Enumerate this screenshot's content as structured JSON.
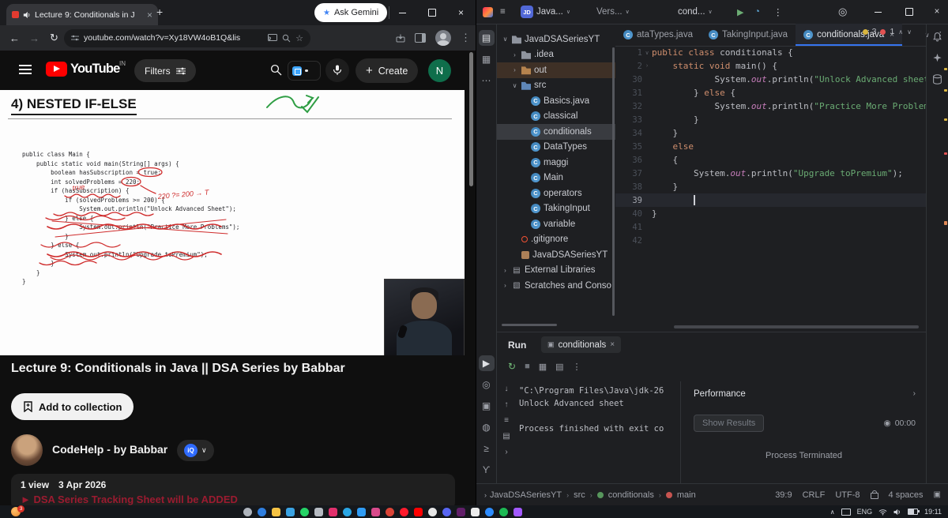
{
  "browser": {
    "tab_title": "Lecture 9: Conditionals in J",
    "ask_gemini": "Ask Gemini",
    "url": "youtube.com/watch?v=Xy18VW4oB1Q&lis",
    "yt": {
      "logo": "YouTube",
      "region": "IN",
      "filters": "Filters",
      "create": "Create",
      "avatar_initial": "N",
      "heading": "4) NESTED IF-ELSE",
      "whiteboard": {
        "code": [
          "public class Main {",
          "    public static void main(String[] args) {",
          "        boolean hasSubscription = true;",
          "        int solvedProblems = 220;",
          "        if (hasSubscription) {",
          "            if (solvedProblems >= 200) {",
          "                System.out.println(\"Unlock Advanced Sheet\");",
          "            } else {",
          "                System.out.println(\"Practice More Problems\");",
          "            }",
          "        } else {",
          "            System.out.println(\"Upgrade toPremium\");",
          "        }",
          "    }",
          "}"
        ]
      },
      "annotations": {
        "expr": "220 ?= 200 → T",
        "true_note": "true"
      },
      "title": "Lecture 9: Conditionals in Java || DSA Series by Babbar",
      "add_to_collection": "Add to collection",
      "channel": "CodeHelp - by Babbar",
      "badge": "iQ",
      "views": "1 view",
      "date": "3 Apr 2026",
      "banner": "► DSA Series Tracking Sheet will be ADDED"
    }
  },
  "ide": {
    "titlebar": {
      "project_avatar": "JD",
      "project_short": "Java...",
      "vcs_short": "Vers...",
      "run_config_short": "cond..."
    },
    "left_strip_top": [
      {
        "name": "project-tool-icon",
        "glyph": "▤",
        "active": true
      },
      {
        "name": "structure-tool-icon",
        "glyph": "▦"
      },
      {
        "name": "more-tools-icon",
        "glyph": "⋯"
      }
    ],
    "left_strip_bottom": [
      {
        "name": "run-tool-icon",
        "glyph": "▶",
        "active": true
      },
      {
        "name": "services-tool-icon",
        "glyph": "◎"
      },
      {
        "name": "build-tool-icon",
        "glyph": "▣"
      },
      {
        "name": "problems-tool-icon",
        "glyph": "◍"
      },
      {
        "name": "terminal-tool-icon",
        "glyph": "≥"
      },
      {
        "name": "git-tool-icon",
        "glyph": "ϒ"
      }
    ],
    "project_tree": [
      {
        "label": "JavaDSASeriesYT",
        "indent": 0,
        "chevron": "v",
        "icon": "folder"
      },
      {
        "label": ".idea",
        "indent": 1,
        "chevron": ">",
        "icon": "folder"
      },
      {
        "label": "out",
        "indent": 1,
        "chevron": ">",
        "icon": "folder-out",
        "tint": true
      },
      {
        "label": "src",
        "indent": 1,
        "chevron": "v",
        "icon": "folder-src"
      },
      {
        "label": "Basics.java",
        "indent": 2,
        "icon": "class"
      },
      {
        "label": "classical",
        "indent": 2,
        "icon": "class"
      },
      {
        "label": "conditionals",
        "indent": 2,
        "icon": "class",
        "selected": true
      },
      {
        "label": "DataTypes",
        "indent": 2,
        "icon": "class"
      },
      {
        "label": "maggi",
        "indent": 2,
        "icon": "class"
      },
      {
        "label": "Main",
        "indent": 2,
        "icon": "class"
      },
      {
        "label": "operators",
        "indent": 2,
        "icon": "class"
      },
      {
        "label": "TakingInput",
        "indent": 2,
        "icon": "class"
      },
      {
        "label": "variable",
        "indent": 2,
        "icon": "class"
      },
      {
        "label": ".gitignore",
        "indent": 1,
        "icon": "git"
      },
      {
        "label": "JavaDSASeriesYT",
        "indent": 1,
        "icon": "module"
      },
      {
        "label": "External Libraries",
        "indent": 0,
        "chevron": ">",
        "icon": "lib"
      },
      {
        "label": "Scratches and Conso",
        "indent": 0,
        "chevron": ">",
        "icon": "scratch"
      }
    ],
    "tabs": [
      {
        "label": "ataTypes.java"
      },
      {
        "label": "TakingInput.java"
      },
      {
        "label": "conditionals.java",
        "active": true
      }
    ],
    "inspections": {
      "warnings": "3",
      "errors": "1"
    },
    "editor": {
      "lines": [
        {
          "n": "1",
          "fold": "v",
          "s": [
            [
              "kw",
              "public class "
            ],
            [
              "pl",
              "conditionals {"
            ]
          ]
        },
        {
          "n": "2",
          "fold": ">",
          "s": [
            [
              "pl",
              "    "
            ],
            [
              "kw",
              "static void "
            ],
            [
              "pl",
              "main() {"
            ]
          ]
        },
        {
          "n": "30",
          "s": [
            [
              "pl",
              "            System."
            ],
            [
              "fld",
              "out"
            ],
            [
              "pl",
              ".println("
            ],
            [
              "str",
              "\"Unlock Advanced sheet"
            ]
          ]
        },
        {
          "n": "31",
          "s": [
            [
              "pl",
              "        } "
            ],
            [
              "kw",
              "else"
            ],
            [
              "pl",
              " {"
            ]
          ]
        },
        {
          "n": "32",
          "s": [
            [
              "pl",
              "            System."
            ],
            [
              "fld",
              "out"
            ],
            [
              "pl",
              ".println("
            ],
            [
              "str",
              "\"Practice More Problem"
            ]
          ]
        },
        {
          "n": "33",
          "s": [
            [
              "pl",
              "        }"
            ]
          ]
        },
        {
          "n": "34",
          "s": [
            [
              "pl",
              "    }"
            ]
          ]
        },
        {
          "n": "35",
          "s": [
            [
              "pl",
              "    "
            ],
            [
              "kw",
              "else"
            ]
          ]
        },
        {
          "n": "36",
          "s": [
            [
              "pl",
              "    {"
            ]
          ]
        },
        {
          "n": "37",
          "s": [
            [
              "pl",
              "        System."
            ],
            [
              "fld",
              "out"
            ],
            [
              "pl",
              ".println("
            ],
            [
              "str",
              "\"Upgrade toPremium\""
            ],
            [
              "pl",
              ");"
            ]
          ]
        },
        {
          "n": "38",
          "s": [
            [
              "pl",
              "    }"
            ]
          ]
        },
        {
          "n": "39",
          "s": [],
          "current": true
        },
        {
          "n": "40",
          "s": [
            [
              "pl",
              "}"
            ]
          ]
        },
        {
          "n": "41",
          "s": []
        },
        {
          "n": "42",
          "s": []
        }
      ]
    },
    "run": {
      "label": "Run",
      "tab": "conditionals",
      "console": [
        "\"C:\\Program Files\\Java\\jdk-26",
        "Unlock Advanced sheet",
        "",
        "Process finished with exit co"
      ],
      "rail_icons": [
        {
          "name": "scroll-to-end-icon",
          "glyph": "↓"
        },
        {
          "name": "scroll-to-start-icon",
          "glyph": "↑"
        },
        {
          "name": "soft-wrap-icon",
          "glyph": "≡"
        },
        {
          "name": "print-console-icon",
          "glyph": "▤"
        },
        {
          "name": "more-console-icon",
          "glyph": "›"
        }
      ],
      "performance": {
        "title": "Performance",
        "show_results": "Show Results",
        "timer": "00:00",
        "status": "Process Terminated"
      }
    },
    "status": {
      "crumbs": [
        "JavaDSASeriesYT",
        "src",
        "conditionals",
        "main"
      ],
      "caret": "39:9",
      "line_sep": "CRLF",
      "encoding": "UTF-8",
      "indent": "4 spaces"
    }
  },
  "taskbar": {
    "badge": "3",
    "apps": [
      {
        "name": "search-app-icon",
        "color": "#aeb4bc",
        "round": true
      },
      {
        "name": "edge-app-icon",
        "color": "#2f7fe0",
        "round": true
      },
      {
        "name": "explorer-app-icon",
        "color": "#f6c344"
      },
      {
        "name": "store-app-icon",
        "color": "#3aa3e3"
      },
      {
        "name": "whatsapp-app-icon",
        "color": "#25d366",
        "round": true
      },
      {
        "name": "camera-app-icon",
        "color": "#b6bbc2"
      },
      {
        "name": "instagram-app-icon",
        "color": "#e1306c"
      },
      {
        "name": "telegram-app-icon",
        "color": "#2aa6e4",
        "round": true
      },
      {
        "name": "vscode-app-icon",
        "color": "#2f9cf4"
      },
      {
        "name": "jetbrains-app-icon",
        "color": "#d84a8b"
      },
      {
        "name": "chrome-app-icon",
        "color": "#db4437",
        "round": true
      },
      {
        "name": "opera-app-icon",
        "color": "#ff1b2d",
        "round": true
      },
      {
        "name": "youtube-app-icon",
        "color": "#ff0000"
      },
      {
        "name": "github-app-icon",
        "color": "#e6e6e6",
        "round": true
      },
      {
        "name": "discord-app-icon",
        "color": "#5865f2",
        "round": true
      },
      {
        "name": "slack-app-icon",
        "color": "#611f69"
      },
      {
        "name": "notion-app-icon",
        "color": "#ececec"
      },
      {
        "name": "zoom-app-icon",
        "color": "#2d8cff",
        "round": true
      },
      {
        "name": "spotify-app-icon",
        "color": "#1db954",
        "round": true
      },
      {
        "name": "figma-app-icon",
        "color": "#a259ff"
      }
    ],
    "tray": {
      "lang": "ENG",
      "time": "19:11"
    }
  }
}
